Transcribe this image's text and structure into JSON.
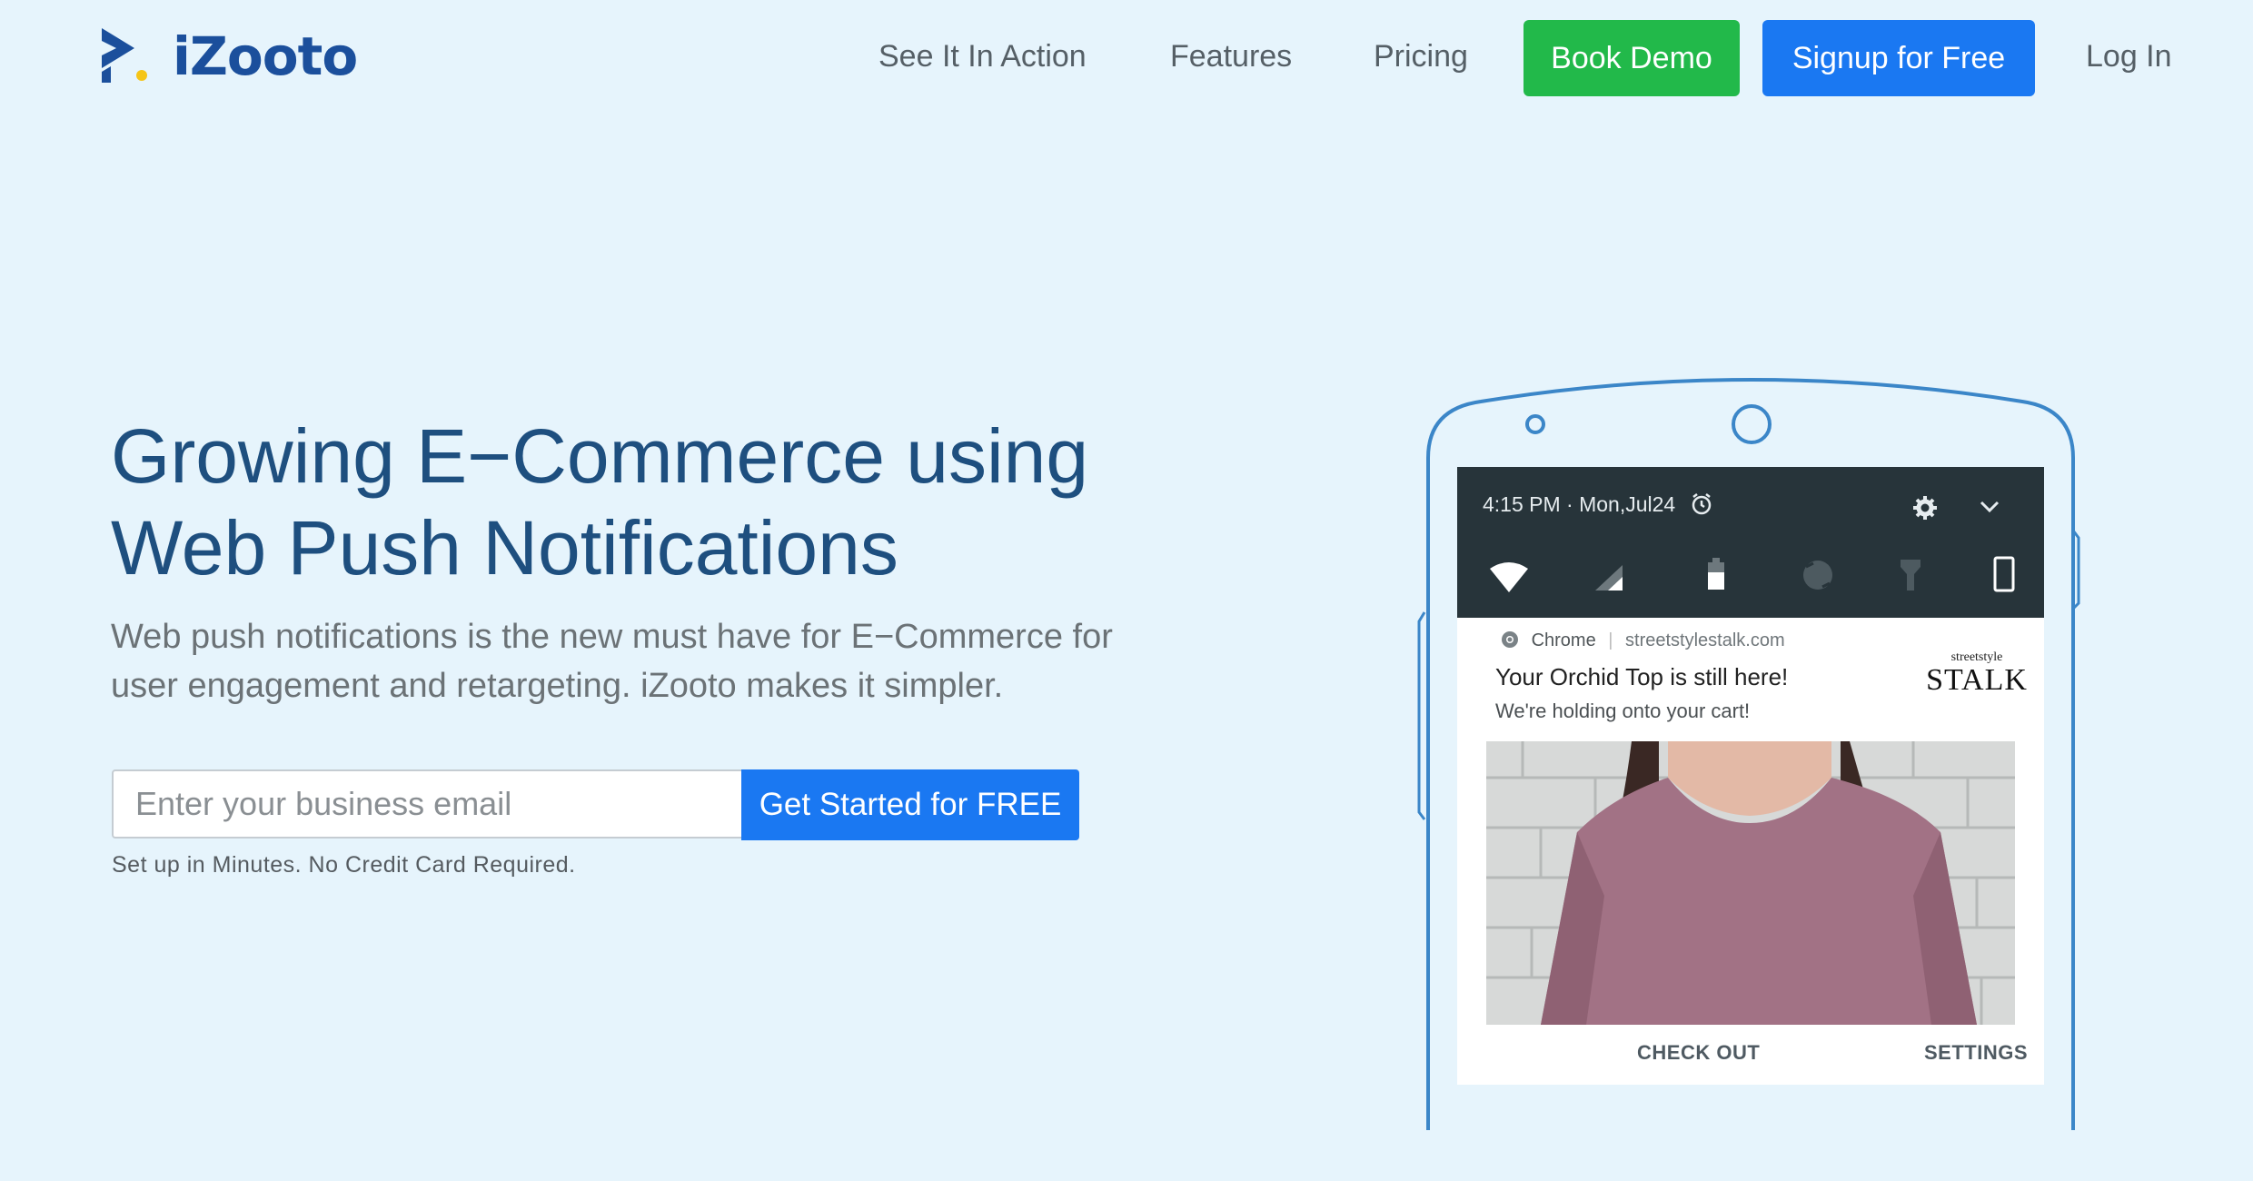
{
  "header": {
    "logo_text": "iZooto",
    "nav": [
      "See It In Action",
      "Features",
      "Pricing"
    ],
    "book_demo": "Book Demo",
    "signup": "Signup for Free",
    "login": "Log In"
  },
  "hero": {
    "title_line1": "Growing E−Commerce using",
    "title_line2": "Web Push Notifications",
    "subtitle_line1": "Web push notifications is the new must have for E−Commerce for",
    "subtitle_line2": "user engagement and retargeting. iZooto makes it simpler.",
    "email_placeholder": "Enter your business email",
    "cta": "Get Started for FREE",
    "note": "Set up in Minutes. No Credit Card Required."
  },
  "phone": {
    "status_time": "4:15 PM · Mon,Jul24",
    "notification": {
      "app": "Chrome",
      "site": "streetstylestalk.com",
      "title": "Your Orchid Top is still here!",
      "body": "We're holding onto your cart!",
      "brand_small": "streetstyle",
      "brand_big": "STALK",
      "action_checkout": "CHECK OUT",
      "action_settings": "SETTINGS"
    }
  },
  "colors": {
    "background": "#e6f4fc",
    "brand_blue": "#1b4f9c",
    "green": "#22b94a",
    "button_blue": "#1a78f2",
    "logo_yellow": "#f5c518"
  },
  "icons": [
    "logo-mark",
    "alarm-icon",
    "gear-icon",
    "chevron-down-icon",
    "wifi-icon",
    "signal-icon",
    "battery-icon",
    "rotate-icon",
    "flashlight-icon",
    "phone-icon",
    "chrome-icon"
  ]
}
